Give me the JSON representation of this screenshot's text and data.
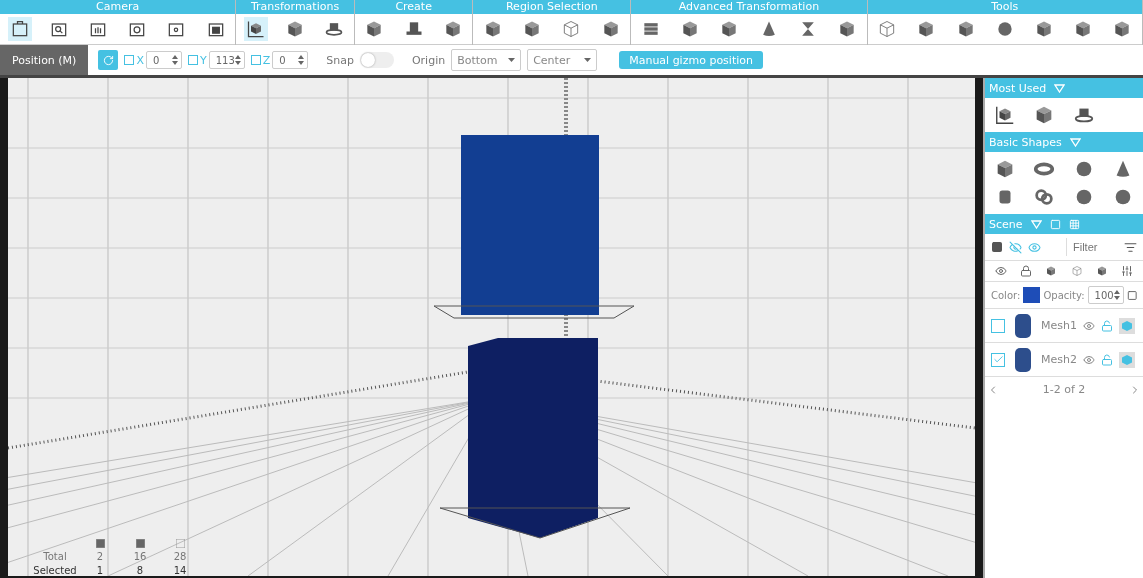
{
  "ribbon": [
    {
      "label": "Camera",
      "tools": [
        {
          "kind": "view",
          "selected": true
        },
        {
          "kind": "zoom",
          "selected": false
        },
        {
          "kind": "pan",
          "selected": false
        },
        {
          "kind": "rotate",
          "selected": false
        },
        {
          "kind": "focus",
          "selected": false
        },
        {
          "kind": "frame",
          "selected": false
        }
      ]
    },
    {
      "label": "Transformations",
      "tools": [
        {
          "kind": "move",
          "selected": true
        },
        {
          "kind": "cube",
          "selected": false
        },
        {
          "kind": "spin",
          "selected": false
        }
      ]
    },
    {
      "label": "Create",
      "tools": [
        {
          "kind": "cube",
          "selected": false
        },
        {
          "kind": "hat",
          "selected": false
        },
        {
          "kind": "cube",
          "selected": false
        }
      ]
    },
    {
      "label": "Region Selection",
      "tools": [
        {
          "kind": "cube",
          "selected": false
        },
        {
          "kind": "cube",
          "selected": false
        },
        {
          "kind": "wire",
          "selected": false
        },
        {
          "kind": "cube",
          "selected": false
        }
      ]
    },
    {
      "label": "Advanced Transformation",
      "tools": [
        {
          "kind": "stack",
          "selected": false
        },
        {
          "kind": "cube",
          "selected": false
        },
        {
          "kind": "cube",
          "selected": false
        },
        {
          "kind": "cone",
          "selected": false
        },
        {
          "kind": "twist",
          "selected": false
        },
        {
          "kind": "cube",
          "selected": false
        }
      ]
    },
    {
      "label": "Tools",
      "tools": [
        {
          "kind": "wire",
          "selected": false
        },
        {
          "kind": "cube",
          "selected": false
        },
        {
          "kind": "cube",
          "selected": false
        },
        {
          "kind": "sphere",
          "selected": false
        },
        {
          "kind": "cube",
          "selected": false
        },
        {
          "kind": "cube",
          "selected": false
        },
        {
          "kind": "cube",
          "selected": false
        }
      ]
    }
  ],
  "position_bar": {
    "mode": "Position (M)",
    "axes": [
      {
        "label": "X",
        "value": "0",
        "checked": false
      },
      {
        "label": "Y",
        "value": "113",
        "checked": false
      },
      {
        "label": "Z",
        "value": "0",
        "checked": false
      }
    ],
    "snap": {
      "label": "Snap",
      "on": false
    },
    "origin_label": "Origin",
    "dropdowns": [
      "Bottom",
      "Center"
    ],
    "button": "Manual gizmo position"
  },
  "stats": {
    "rows": [
      {
        "label": "Total",
        "values": [
          "2",
          "16",
          "28"
        ]
      },
      {
        "label": "Selected",
        "values": [
          "1",
          "8",
          "14"
        ]
      }
    ]
  },
  "panel": {
    "most_used": {
      "title": "Most Used",
      "tools": [
        {
          "kind": "move"
        },
        {
          "kind": "cube"
        },
        {
          "kind": "spin"
        }
      ]
    },
    "basic_shapes": {
      "title": "Basic Shapes",
      "tools": [
        {
          "kind": "cube"
        },
        {
          "kind": "torus"
        },
        {
          "kind": "sphere"
        },
        {
          "kind": "cone"
        },
        {
          "kind": "cylinder"
        },
        {
          "kind": "knot"
        },
        {
          "kind": "sphere"
        },
        {
          "kind": "sphere"
        }
      ]
    },
    "scene": {
      "title": "Scene",
      "filter_placeholder": "Filter",
      "color_label": "Color:",
      "color": "#1e4db7",
      "opacity_label": "Opacity:",
      "opacity": "100",
      "meshes": [
        {
          "name": "Mesh1",
          "checked": false
        },
        {
          "name": "Mesh2",
          "checked": true
        }
      ],
      "pager": "1-2 of 2"
    }
  }
}
